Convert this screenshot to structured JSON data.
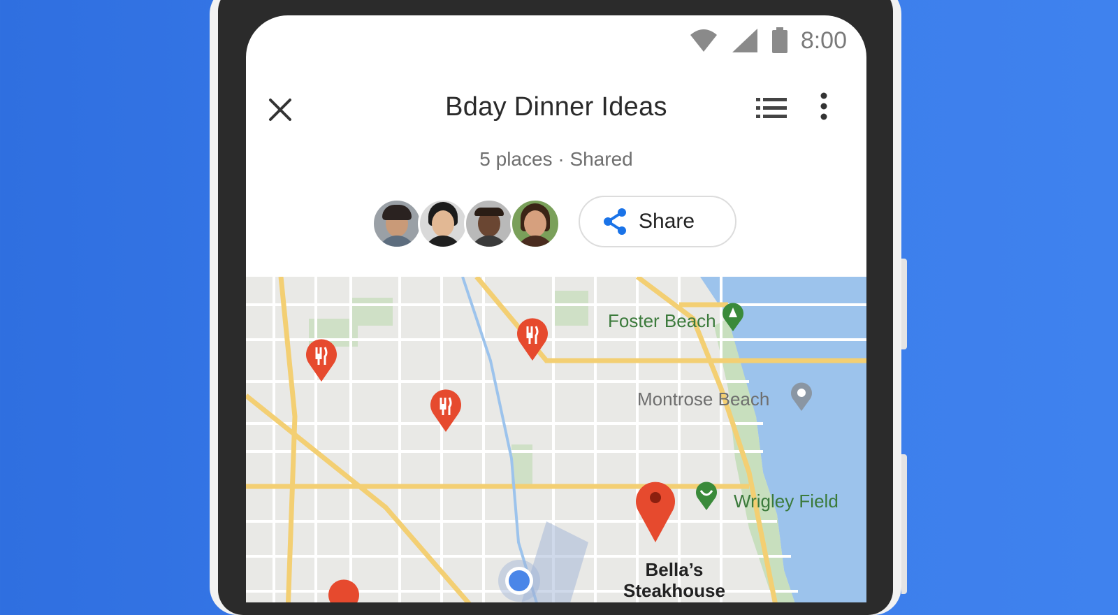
{
  "status_bar": {
    "time": "8:00",
    "icons": [
      "wifi-icon",
      "signal-icon",
      "battery-icon"
    ]
  },
  "header": {
    "title": "Bday Dinner Ideas",
    "subtitle": "5 places · Shared",
    "close_icon": "close-icon",
    "list_icon": "list-view-icon",
    "more_icon": "more-vert-icon"
  },
  "collaborators": {
    "count": 4
  },
  "share_button": {
    "label": "Share",
    "icon": "share-icon"
  },
  "map": {
    "poi": {
      "foster_beach": "Foster Beach",
      "montrose_beach": "Montrose Beach",
      "wrigley_field": "Wrigley Field",
      "bellas_line1": "Bella’s",
      "bellas_line2": "Steakhouse"
    },
    "colors": {
      "restaurant_pin": "#e64a2e",
      "park_green": "#3a8a3a",
      "water": "#9cc3ec",
      "road": "#f3cf73"
    }
  }
}
